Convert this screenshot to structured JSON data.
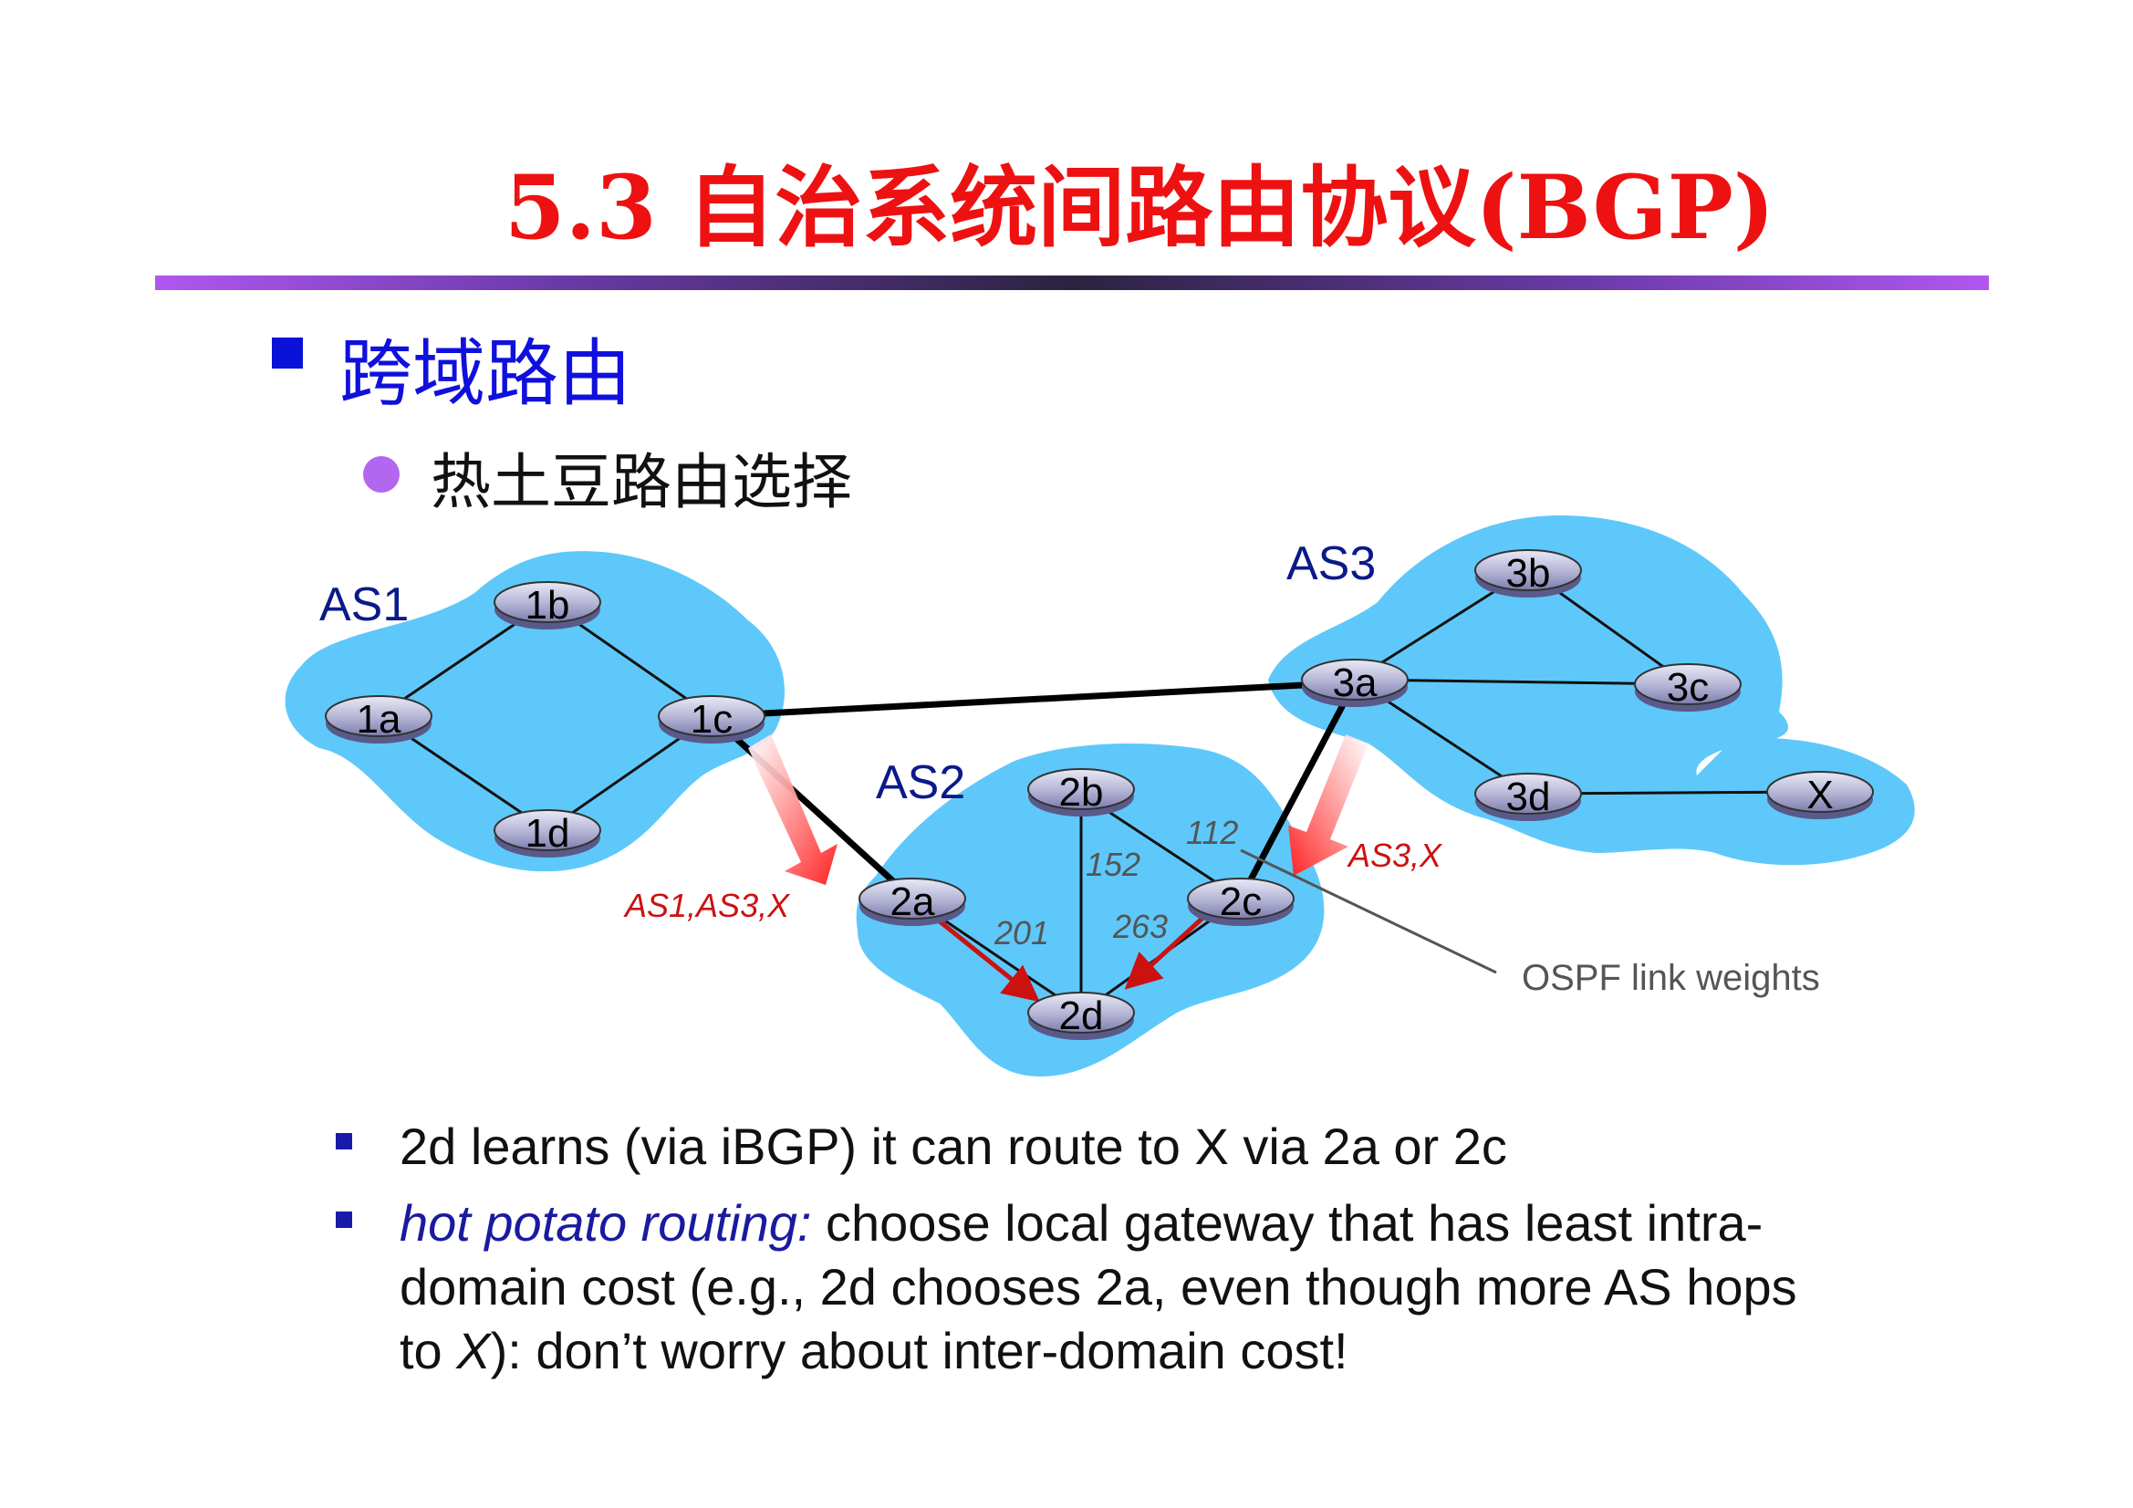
{
  "title": "5.3 自治系统间路由协议(BGP)",
  "heading": {
    "bullet_color": "#0b12d8",
    "text": "跨域路由"
  },
  "subheading": {
    "bullet_color": "#b366f0",
    "text": "热土豆路由选择"
  },
  "diagram": {
    "as_labels": {
      "as1": "AS1",
      "as2": "AS2",
      "as3": "AS3"
    },
    "routers": {
      "r1a": "1a",
      "r1b": "1b",
      "r1c": "1c",
      "r1d": "1d",
      "r2a": "2a",
      "r2b": "2b",
      "r2c": "2c",
      "r2d": "2d",
      "r3a": "3a",
      "r3b": "3b",
      "r3c": "3c",
      "r3d": "3d",
      "rx": "X"
    },
    "link_weights": {
      "w201": "201",
      "w152": "152",
      "w263": "263",
      "w112": "112"
    },
    "advertisements": {
      "to_2a": "AS1,AS3,X",
      "to_2c": "AS3,X"
    },
    "ospf_label": "OSPF link weights",
    "colors": {
      "cloud": "#5ec8fa",
      "advert": "#cc1111",
      "weights": "#555555",
      "as_label": "#0a1a8a"
    }
  },
  "bullets": [
    {
      "text": "2d learns (via iBGP) it can route to X via 2a or 2c"
    },
    {
      "emph": "hot potato routing:",
      "line1": " choose local gateway that has least intra-",
      "line2": "domain cost (e.g., 2d chooses 2a, even though more AS hops",
      "line3_pre": "to ",
      "line3_x": "X",
      "line3_post": "): don’t worry about inter-domain cost!"
    }
  ]
}
